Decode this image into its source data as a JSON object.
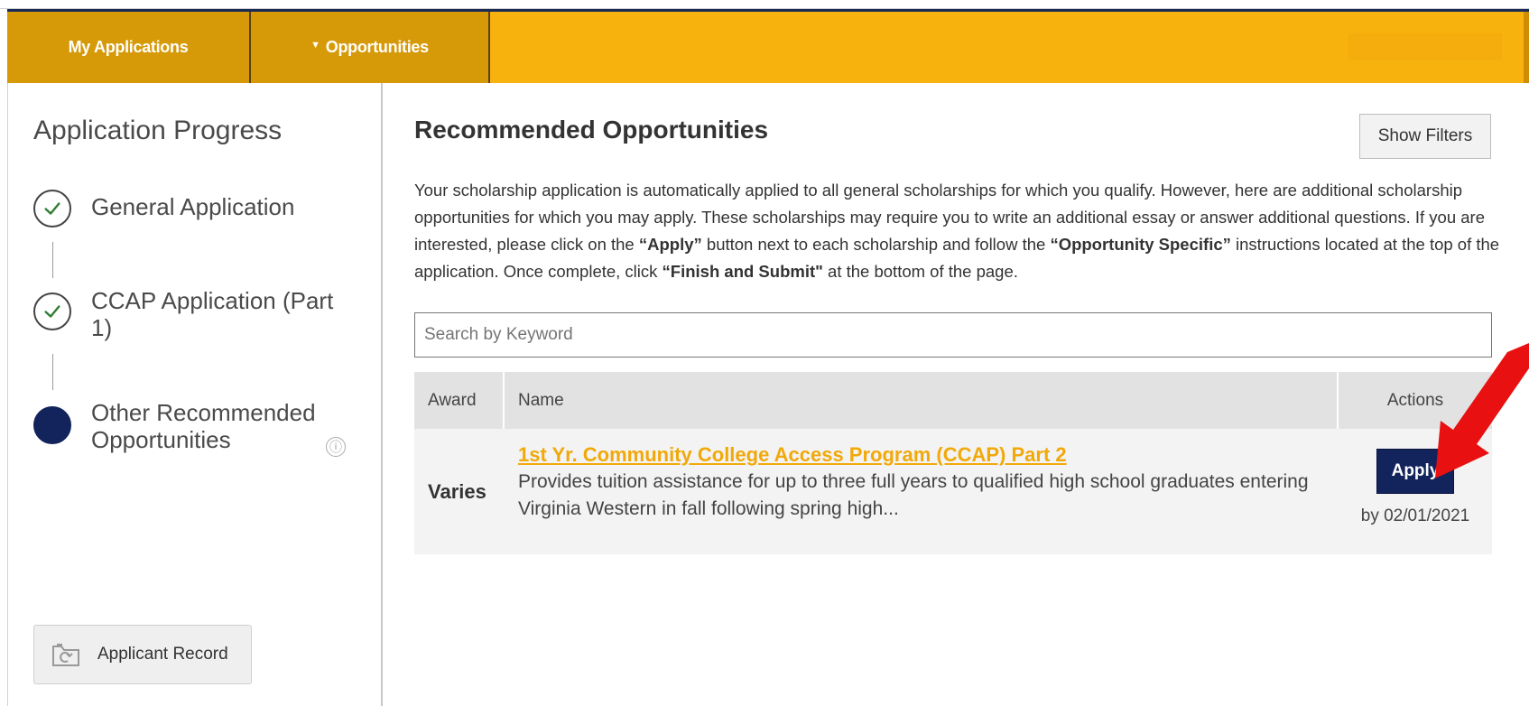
{
  "nav": {
    "tabs": [
      {
        "label": "My Applications"
      },
      {
        "label": "Opportunities",
        "caret": "▼"
      }
    ]
  },
  "sidebar": {
    "title": "Application Progress",
    "steps": [
      {
        "label": "General Application",
        "status": "complete"
      },
      {
        "label": "CCAP Application (Part 1)",
        "status": "complete"
      },
      {
        "label": "Other Recommended Opportunities",
        "status": "current"
      }
    ],
    "info_icon": "ⓘ",
    "record_button": {
      "label": "Applicant Record",
      "icon": "folder-refresh-icon"
    }
  },
  "main": {
    "title": "Recommended Opportunities",
    "filters_button": "Show Filters",
    "intro": {
      "part1": "Your scholarship application is automatically applied to all general scholarships for which you qualify. However, here are additional scholarship opportunities for which you may apply. These scholarships may require you to write an additional essay or answer additional questions. If you are interested, please click on the ",
      "apply_word": "“Apply”",
      "part2": " button next to each scholarship and follow the ",
      "specific_words": "“Opportunity Specific”",
      "part3": " instructions located at the top of the application. Once complete, click ",
      "finish_words": "“Finish and Submit\"",
      "part4": " at the bottom of the page."
    },
    "search_placeholder": "Search by Keyword",
    "table": {
      "headers": {
        "award": "Award",
        "name": "Name",
        "actions": "Actions"
      },
      "rows": [
        {
          "award": "Varies",
          "name": "1st Yr. Community College Access Program (CCAP) Part 2",
          "description": "Provides tuition assistance for up to three full years to qualified high school graduates entering Virginia Western in fall following spring high...",
          "action_label": "Apply",
          "due": "by 02/01/2021"
        }
      ]
    }
  },
  "colors": {
    "nav_bg": "#f7b20e",
    "nav_tab": "#d69a08",
    "navy": "#13235b",
    "link": "#f1a90a",
    "arrow": "#e81010"
  }
}
